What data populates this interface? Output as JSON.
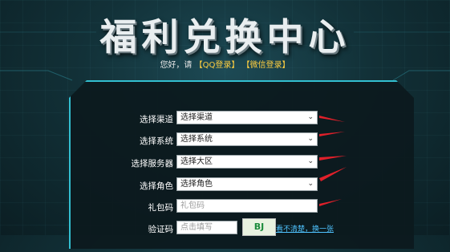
{
  "page": {
    "title": "福利兑换中心",
    "login_prefix": "您好，请",
    "qq_login": "【QQ登录】",
    "wechat_login": "【微信登录】"
  },
  "form": {
    "channel": {
      "label": "选择渠道",
      "value": "选择渠道"
    },
    "system": {
      "label": "选择系统",
      "value": "选择系统"
    },
    "server": {
      "label": "选择服务器",
      "value": "选择大区"
    },
    "role": {
      "label": "选择角色",
      "value": "选择角色"
    },
    "gift_code": {
      "label": "礼包码",
      "placeholder": "礼包码"
    },
    "captcha": {
      "label": "验证码",
      "placeholder": "点击填写",
      "image_text": "BJ",
      "refresh_text": "看不清楚，换一张"
    }
  },
  "colors": {
    "panel_border": "#33bfd0",
    "arrow": "#e0202a",
    "login_link": "#ffcf40"
  }
}
